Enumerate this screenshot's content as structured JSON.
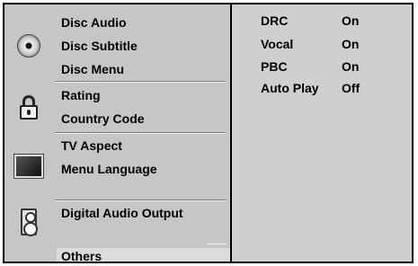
{
  "menu": {
    "groups": [
      {
        "icon": "disc-icon",
        "items": [
          "Disc Audio",
          "Disc Subtitle",
          "Disc Menu"
        ]
      },
      {
        "icon": "lock-icon",
        "items": [
          "Rating",
          "Country Code"
        ]
      },
      {
        "icon": "tv-icon",
        "items": [
          "TV Aspect",
          "Menu Language"
        ]
      },
      {
        "icon": "speaker-icon",
        "items": [
          "Digital Audio Output"
        ]
      }
    ],
    "selected": "Others"
  },
  "settings": [
    {
      "label": "DRC",
      "value": "On"
    },
    {
      "label": "Vocal",
      "value": "On"
    },
    {
      "label": "PBC",
      "value": "On"
    },
    {
      "label": "Auto Play",
      "value": "Off"
    }
  ]
}
